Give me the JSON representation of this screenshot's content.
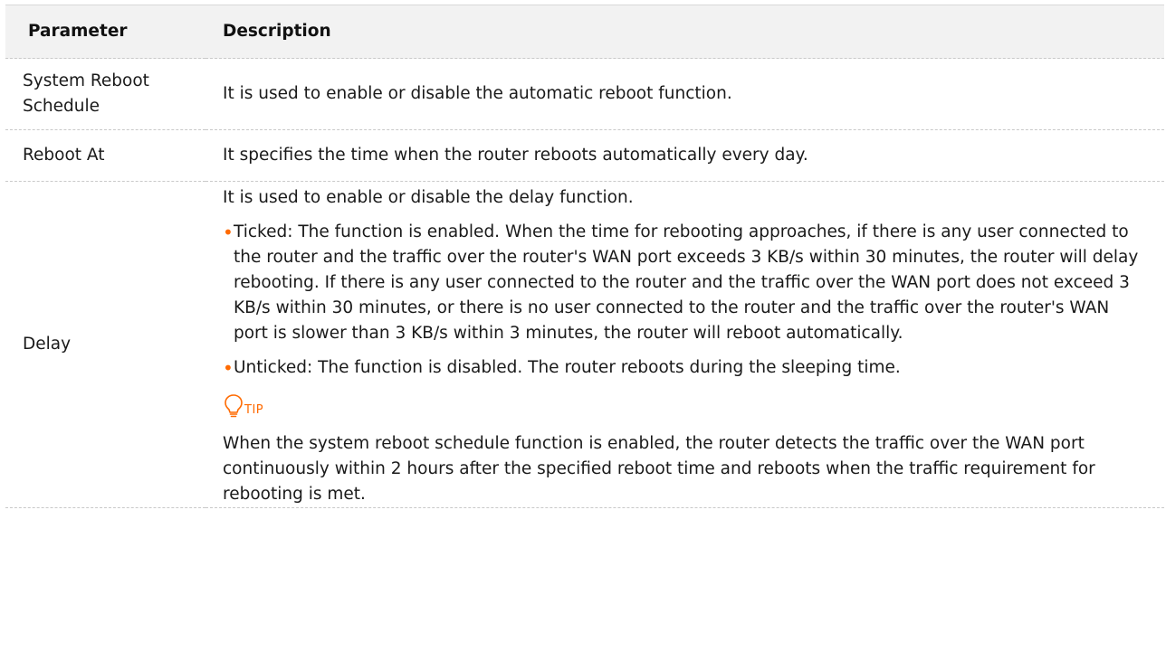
{
  "table": {
    "headers": {
      "parameter": "Parameter",
      "description": "Description"
    },
    "rows": {
      "system_reboot_schedule": {
        "name": "System Reboot Schedule",
        "description": "It is used to enable or disable the automatic reboot function."
      },
      "reboot_at": {
        "name": "Reboot At",
        "description": "It specifies the time when the router reboots automatically every day."
      },
      "delay": {
        "name": "Delay",
        "intro": "It is used to enable or disable the delay function.",
        "bullets": [
          "Ticked: The function is enabled. When the time for rebooting approaches, if there is any user connected to the router and the traffic over the router's WAN port exceeds 3 KB/s within 30 minutes, the router will delay rebooting. If there is any user connected to the router and the traffic over the WAN port does not exceed 3 KB/s within 30 minutes, or there is no user connected to the router and the traffic over the router's WAN port is slower than 3 KB/s within 3 minutes, the router will reboot automatically.",
          "Unticked: The function is disabled. The router reboots during the sleeping time."
        ],
        "bullet_marker": "•",
        "tip": {
          "icon": "lightbulb-icon",
          "label": "TIP",
          "text": "When the system reboot schedule function is enabled, the router detects the traffic over the WAN port continuously within 2 hours after the specified reboot time and reboots when the traffic requirement for rebooting is met."
        }
      }
    }
  },
  "colors": {
    "accent": "#ff6a00",
    "header_bg": "#f2f2f2",
    "divider": "#c9c9c9"
  }
}
